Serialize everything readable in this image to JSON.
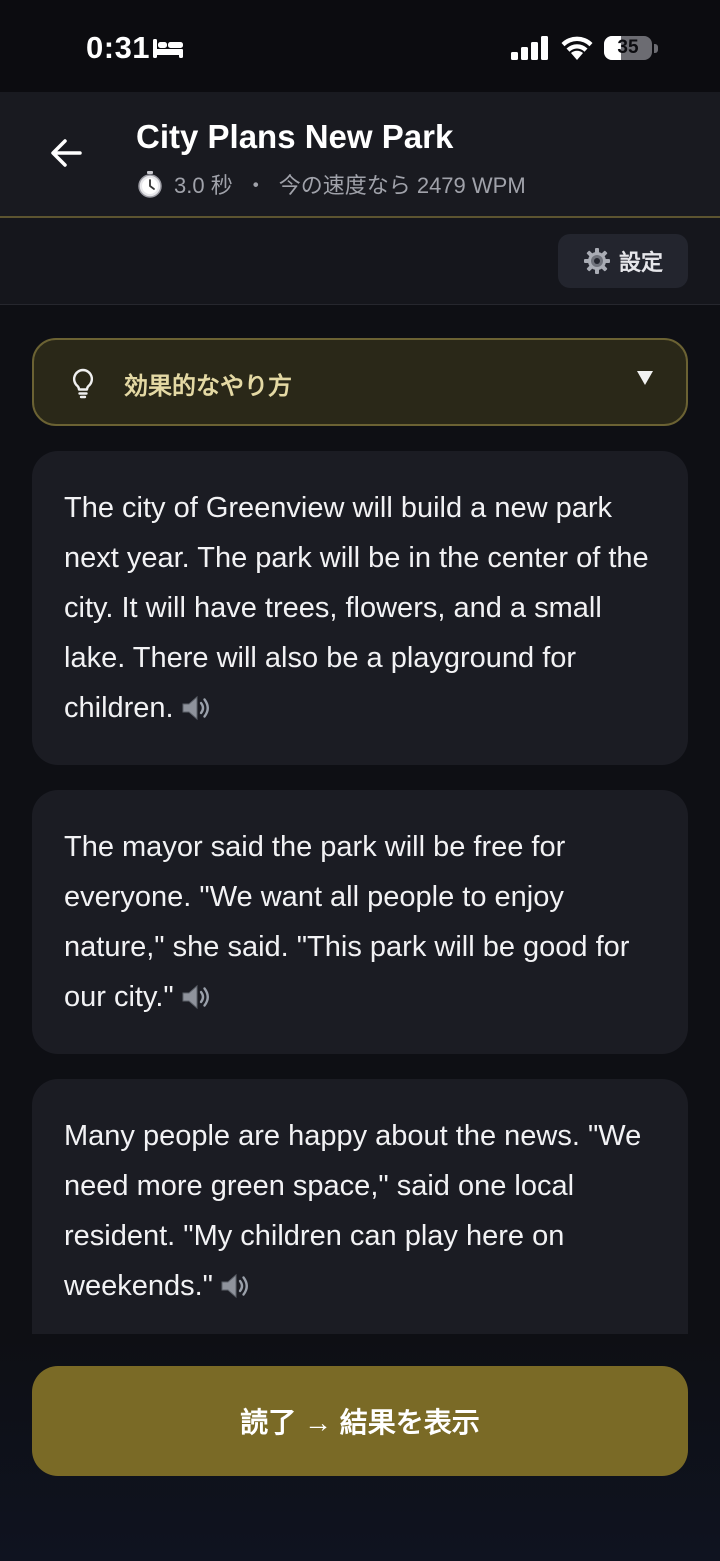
{
  "status_bar": {
    "time": "0:31",
    "battery_level": "35",
    "battery_fraction": 0.35,
    "icons": [
      "bed-icon",
      "signal-icon",
      "wifi-icon",
      "battery-icon"
    ]
  },
  "header": {
    "title": "City Plans New Park",
    "elapsed": "3.0 秒",
    "separator": "・",
    "speed": "今の速度なら 2479 WPM",
    "icons": [
      "back-arrow-icon",
      "stopwatch-icon"
    ]
  },
  "toolbar": {
    "settings_label": "設定",
    "settings_icon": "gear-icon"
  },
  "tips": {
    "label": "効果的なやり方",
    "icon": "lightbulb-icon",
    "caret": "caret-down-icon",
    "accent_color": "#e4d9a4"
  },
  "paragraphs": [
    {
      "text": "The city of Greenview will build a new park next year. The park will be in the center of the city. It will have trees, flowers, and a small lake. There will also be a playground for children."
    },
    {
      "text": "The mayor said the park will be free for everyone. \"We want all people to enjoy nature,\" she said. \"This park will be good for our city.\""
    },
    {
      "text": "Many people are happy about the news. \"We need more green space,\" said one local resident. \"My children can play here on weekends.\""
    }
  ],
  "finish_button": {
    "label": "読了 → 結果を表示",
    "color": "#7a6a26"
  },
  "colors": {
    "background": "#0e0f14",
    "card": "#1b1c23",
    "header_border": "#5c5430"
  }
}
